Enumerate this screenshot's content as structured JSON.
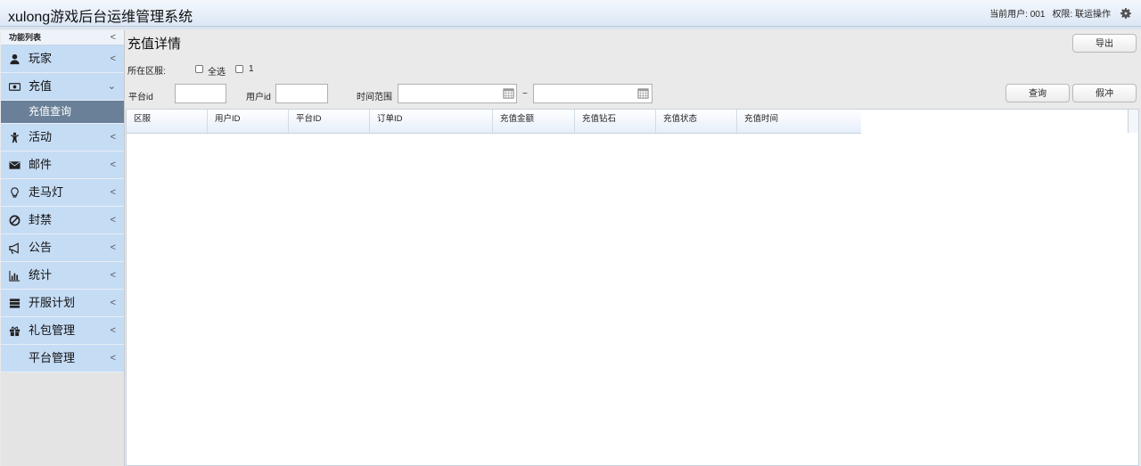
{
  "header": {
    "title": "xulong游戏后台运维管理系统",
    "current_user_label": "当前用户: 001",
    "permission_label": "权限: 联运操作",
    "settings_icon": "gear-icon"
  },
  "sidebar": {
    "title": "功能列表",
    "collapse_icon": "chevron-left-icon",
    "items": [
      {
        "label": "玩家",
        "icon": "user-icon"
      },
      {
        "label": "充值",
        "icon": "money-icon",
        "expanded": true,
        "children": [
          {
            "label": "充值查询",
            "active": true
          }
        ]
      },
      {
        "label": "活动",
        "icon": "child-icon"
      },
      {
        "label": "邮件",
        "icon": "envelope-icon"
      },
      {
        "label": "走马灯",
        "icon": "lightbulb-icon"
      },
      {
        "label": "封禁",
        "icon": "ban-icon"
      },
      {
        "label": "公告",
        "icon": "bullhorn-icon"
      },
      {
        "label": "统计",
        "icon": "bar-chart-icon"
      },
      {
        "label": "开服计划",
        "icon": "server-icon"
      },
      {
        "label": "礼包管理",
        "icon": "gift-icon"
      },
      {
        "label": "平台管理",
        "icon": ""
      }
    ]
  },
  "main": {
    "title": "充值详情",
    "export_label": "导出",
    "server_label": "所在区服:",
    "checkboxes": [
      {
        "label": "全选",
        "checked": false
      },
      {
        "label": "1",
        "checked": false
      }
    ],
    "platform_id_label": "平台id",
    "platform_id_value": "",
    "user_id_label": "用户id",
    "user_id_value": "",
    "time_range_label": "时间范围",
    "time_start_value": "",
    "time_end_value": "",
    "range_separator": "~",
    "query_label": "查询",
    "reversal_label": "假冲",
    "table": {
      "columns": [
        "区服",
        "用户ID",
        "平台ID",
        "订单ID",
        "充值金额",
        "充值钻石",
        "充值状态",
        "充值时间"
      ],
      "rows": []
    }
  },
  "colors": {
    "nav_bg": "#c5dcf5",
    "nav_active_bg": "#6a8098",
    "header_bg": "#dce7f5"
  }
}
